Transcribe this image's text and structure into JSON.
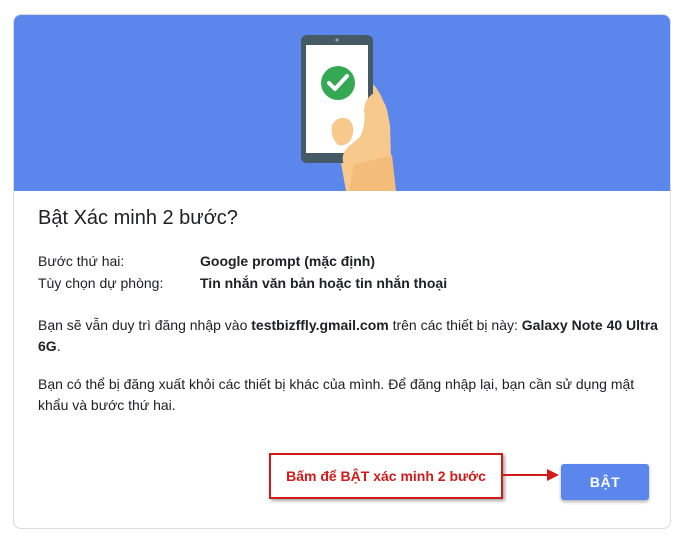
{
  "dialog": {
    "title": "Bật Xác minh 2 bước?",
    "second_step": {
      "label": "Bước thứ hai:",
      "value": "Google prompt (mặc định)"
    },
    "backup_option": {
      "label": "Tùy chọn dự phòng:",
      "value": "Tin nhắn văn bản hoặc tin nhắn thoại"
    },
    "paragraph1": {
      "before_email": "Bạn sẽ vẫn duy trì đăng nhập vào ",
      "email": "testbizffly.gmail.com",
      "middle": " trên các thiết bị này: ",
      "device": "Galaxy Note 40 Ultra 6G",
      "end": "."
    },
    "paragraph2": "Bạn có thể bị đăng xuất khỏi các thiết bị khác của mình. Để đăng nhập lại, bạn cần sử dụng mật khẩu và bước thứ hai.",
    "turn_on_button": "BẬT",
    "annotation": "Bấm để BẬT xác minh 2 bước"
  },
  "colors": {
    "hero_background": "#5b86ec",
    "button": "#5b86ec",
    "check_circle": "#34a853",
    "annotation_red": "#d11a1a"
  },
  "icons": [
    "phone-in-hand-illustration",
    "checkmark-icon",
    "arrow-icon"
  ]
}
